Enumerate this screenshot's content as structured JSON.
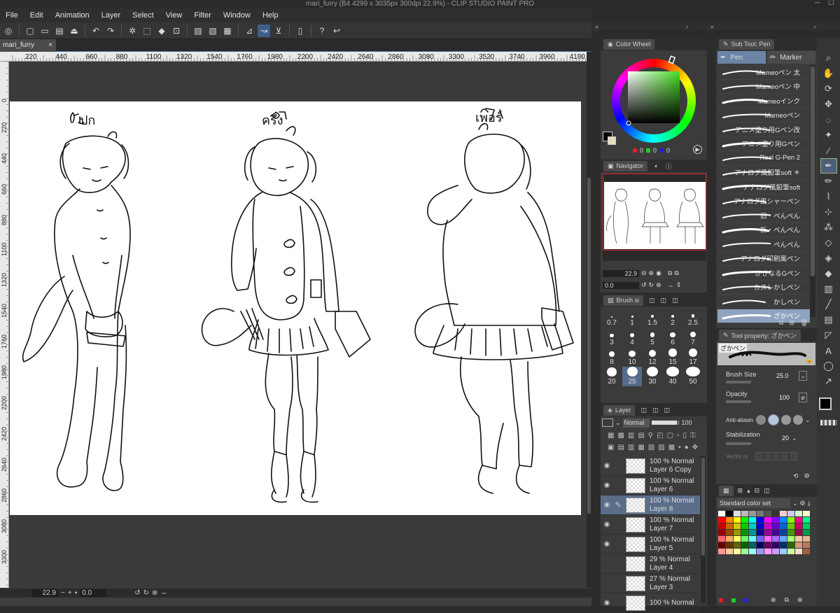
{
  "title": "mari_furry (B4 4299 x 3035px 300dpi 22.9%)  - CLIP STUDIO PAINT PRO",
  "menu": [
    "File",
    "Edit",
    "Animation",
    "Layer",
    "Select",
    "View",
    "Filter",
    "Window",
    "Help"
  ],
  "doc_tab": {
    "name": "mari_furry",
    "close": "×"
  },
  "ruler_h_ticks": [
    "220",
    "440",
    "660",
    "880",
    "1100",
    "1320",
    "1540",
    "1760",
    "1980",
    "2200",
    "2420",
    "2640",
    "2860",
    "3080",
    "3300",
    "3520",
    "3740",
    "3960",
    "4180"
  ],
  "ruler_v_ticks": [
    "0",
    "220",
    "440",
    "660",
    "880",
    "1100",
    "1320",
    "1540",
    "1760",
    "1980",
    "2200",
    "2420",
    "2640",
    "2860",
    "3080",
    "3300"
  ],
  "canvas_labels": [
    "ปก",
    "ครึ่ง",
    "เพอร์"
  ],
  "status": {
    "zoom": "22.9",
    "angle": "0.0"
  },
  "color_wheel": {
    "tab": "Color Wheel",
    "rgb_values": [
      "0",
      "0",
      "0"
    ],
    "main_color": "#000000",
    "sub_color": "#e8dcc0",
    "hue_square": "#44dd22"
  },
  "navigator": {
    "tab": "Navigator",
    "zoom": "22.9",
    "angle": "0.0"
  },
  "brush_size": {
    "tab": "Brush si",
    "sizes": [
      "0.7",
      "1",
      "1.5",
      "2",
      "2.5",
      "3",
      "4",
      "5",
      "6",
      "7",
      "8",
      "10",
      "12",
      "15",
      "17",
      "20",
      "25",
      "30",
      "40",
      "50"
    ],
    "selected": "25"
  },
  "layer": {
    "tab": "Layer",
    "blend": "Normal",
    "opacity": "100",
    "layers": [
      {
        "opacity": "100 % Normal",
        "name": "Layer 6 Copy",
        "visible": true,
        "selected": false
      },
      {
        "opacity": "100 % Normal",
        "name": "Layer 6",
        "visible": true,
        "selected": false
      },
      {
        "opacity": "100 % Normal",
        "name": "Layer 8",
        "visible": true,
        "selected": true
      },
      {
        "opacity": "100 % Normal",
        "name": "Layer 7",
        "visible": true,
        "selected": false
      },
      {
        "opacity": "100 % Normal",
        "name": "Layer 5",
        "visible": true,
        "selected": false
      },
      {
        "opacity": "29 % Normal",
        "name": "Layer 4",
        "visible": false,
        "selected": false
      },
      {
        "opacity": "27 % Normal",
        "name": "Layer 3",
        "visible": false,
        "selected": false
      },
      {
        "opacity": "100 % Normal",
        "name": "",
        "visible": true,
        "selected": false
      }
    ]
  },
  "subtool": {
    "tab": "Sub Tool: Pen",
    "groups": [
      "Pen",
      "Marker"
    ],
    "items": [
      "Mameoペン 太",
      "Mameoペン 中",
      "Mameoインク",
      "Mameoペン",
      "アニメ塗り用Gペン改",
      "アニメ塗り用Gペン",
      "Real G-Pen 2",
      "アナログ風鉛筆soft ＊",
      "アナログ風鉛筆soft",
      "アナログ風シャーペン",
      "旧・ぺんぺん",
      "新・ぺんぺん",
      "ぺんぺん",
      "アナログ印刷風ペン",
      "かさなるGペン",
      "カスレかしペン",
      "かしペン",
      "ざかペン"
    ],
    "selected": "ざかペン"
  },
  "tool_property": {
    "tab": "Tool property: ざかペン",
    "preview_label": "ざかペン",
    "brush_size_label": "Brush Size",
    "brush_size": "25.0",
    "opacity_label": "Opacity",
    "opacity": "100",
    "antialias_label": "Anti-aliasin",
    "stabilization_label": "Stabilization",
    "stabilization": "20",
    "vector_label": "Vector m"
  },
  "color_set": {
    "name": "Standard color set",
    "swatches": [
      "#ffffff",
      "#000000",
      "#dddddd",
      "#bbbbbb",
      "#999999",
      "#777777",
      "#555555",
      "#333333",
      "#ffcccc",
      "#ccccff",
      "#ccffcc",
      "#ffffcc",
      "#ff0000",
      "#ff8800",
      "#ffff00",
      "#00ff00",
      "#00ffff",
      "#0000ff",
      "#ff00ff",
      "#8800ff",
      "#0088ff",
      "#88ff00",
      "#ff0088",
      "#00ff88",
      "#cc0000",
      "#cc6600",
      "#cccc00",
      "#00cc00",
      "#00cccc",
      "#0000cc",
      "#cc00cc",
      "#6600cc",
      "#0066cc",
      "#66cc00",
      "#cc0066",
      "#00cc66",
      "#990000",
      "#994400",
      "#999900",
      "#009900",
      "#009999",
      "#000099",
      "#990099",
      "#440099",
      "#004499",
      "#449900",
      "#990044",
      "#009944",
      "#ff6666",
      "#ffaa66",
      "#ffff66",
      "#66ff66",
      "#66ffff",
      "#6666ff",
      "#ff66ff",
      "#aa66ff",
      "#66aaff",
      "#aaff66",
      "#f3c9a8",
      "#e8b48f",
      "#660000",
      "#663300",
      "#666600",
      "#006600",
      "#006666",
      "#000066",
      "#660066",
      "#330066",
      "#003366",
      "#336600",
      "#d49a7a",
      "#b87a5a",
      "#ff9999",
      "#ffcc99",
      "#ffff99",
      "#99ff99",
      "#99ffff",
      "#9999ff",
      "#ff99ff",
      "#cc99ff",
      "#99ccff",
      "#ccff99",
      "#f5dcc8",
      "#a06040"
    ]
  }
}
